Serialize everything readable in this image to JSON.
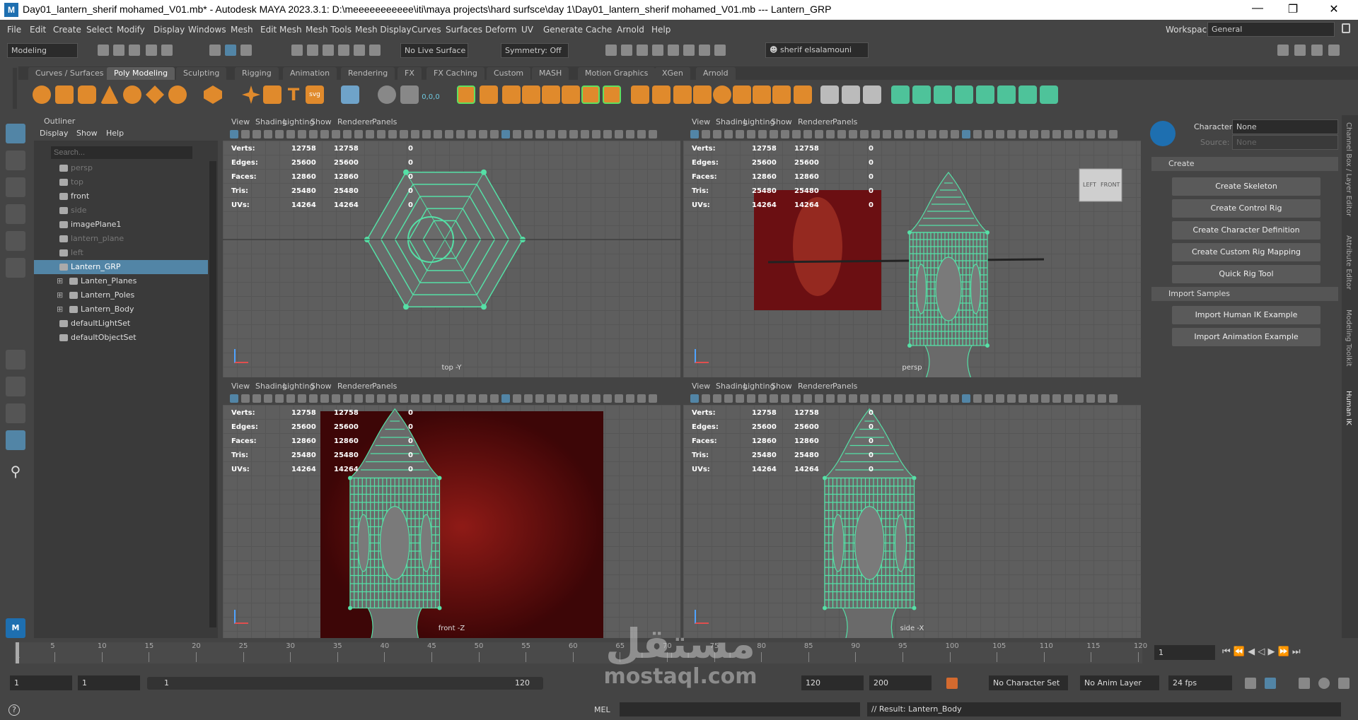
{
  "window": {
    "title": "Day01_lantern_sherif mohamed_V01.mb* - Autodesk MAYA 2023.3.1: D:\\meeeeeeeeeee\\iti\\maya projects\\hard surfsce\\day 1\\Day01_lantern_sherif mohamed_V01.mb  ---  Lantern_GRP",
    "logo": "M"
  },
  "menubar": {
    "items": [
      "File",
      "Edit",
      "Create",
      "Select",
      "Modify",
      "Display",
      "Windows",
      "Mesh",
      "Edit Mesh",
      "Mesh Tools",
      "Mesh Display",
      "Curves",
      "Surfaces",
      "Deform",
      "UV",
      "Generate",
      "Cache",
      "Arnold",
      "Help"
    ],
    "workspace_label": "Workspace:",
    "workspace_value": "General"
  },
  "statusline": {
    "mode": "Modeling",
    "live_surface": "No Live Surface",
    "symmetry": "Symmetry: Off",
    "user": "sherif elsalamouni"
  },
  "shelf": {
    "tabs": [
      "Curves / Surfaces",
      "Poly Modeling",
      "Sculpting",
      "Rigging",
      "Animation",
      "Rendering",
      "FX",
      "FX Caching",
      "Custom",
      "MASH",
      "Motion Graphics",
      "XGen",
      "Arnold"
    ],
    "active": "Poly Modeling"
  },
  "outliner": {
    "title": "Outliner",
    "menu": [
      "Display",
      "Show",
      "Help"
    ],
    "search_placeholder": "Search...",
    "items": [
      {
        "label": "persp",
        "dim": true,
        "indent": 0
      },
      {
        "label": "top",
        "dim": true,
        "indent": 0
      },
      {
        "label": "front",
        "dim": false,
        "indent": 0
      },
      {
        "label": "side",
        "dim": true,
        "indent": 0
      },
      {
        "label": "imagePlane1",
        "dim": false,
        "indent": 0
      },
      {
        "label": "lantern_plane",
        "dim": true,
        "indent": 0
      },
      {
        "label": "left",
        "dim": true,
        "indent": 0
      },
      {
        "label": "Lantern_GRP",
        "dim": false,
        "indent": 0,
        "selected": true
      },
      {
        "label": "Lanten_Planes",
        "dim": false,
        "indent": 1
      },
      {
        "label": "Lantern_Poles",
        "dim": false,
        "indent": 1
      },
      {
        "label": "Lantern_Body",
        "dim": false,
        "indent": 1
      },
      {
        "label": "defaultLightSet",
        "dim": false,
        "indent": 0
      },
      {
        "label": "defaultObjectSet",
        "dim": false,
        "indent": 0
      }
    ]
  },
  "viewport_menu": [
    "View",
    "Shading",
    "Lighting",
    "Show",
    "Renderer",
    "Panels"
  ],
  "hud": {
    "labels": [
      "Verts:",
      "Edges:",
      "Faces:",
      "Tris:",
      "UVs:"
    ],
    "col1": [
      "12758",
      "25600",
      "12860",
      "25480",
      "14264"
    ],
    "col2": [
      "12758",
      "25600",
      "12860",
      "25480",
      "14264"
    ],
    "col3": [
      "0",
      "0",
      "0",
      "0",
      "0"
    ]
  },
  "viewports": [
    {
      "camera": "top -Y"
    },
    {
      "camera": "persp"
    },
    {
      "camera": "front -Z"
    },
    {
      "camera": "side -X"
    }
  ],
  "viewcube": {
    "left": "LEFT",
    "front": "FRONT"
  },
  "humanik": {
    "character_label": "Character:",
    "character_value": "None",
    "source_label": "Source:",
    "source_value": "None",
    "create_section": "Create",
    "create_buttons": [
      "Create Skeleton",
      "Create Control Rig",
      "Create Character Definition",
      "Create Custom Rig Mapping",
      "Quick Rig Tool"
    ],
    "import_section": "Import Samples",
    "import_buttons": [
      "Import Human IK Example",
      "Import Animation Example"
    ]
  },
  "side_tabs": [
    "Channel Box / Layer Editor",
    "Attribute Editor",
    "Modeling Toolkit",
    "Human IK"
  ],
  "timeline": {
    "ticks": [
      "5",
      "10",
      "15",
      "20",
      "25",
      "30",
      "35",
      "40",
      "45",
      "50",
      "55",
      "60",
      "65",
      "70",
      "75",
      "80",
      "85",
      "90",
      "95",
      "100",
      "105",
      "110",
      "115",
      "120"
    ],
    "current_frame": "1",
    "first_tick": "1"
  },
  "range": {
    "start": "1",
    "playback_start": "1",
    "slider_start": "1",
    "slider_end": "120",
    "playback_end": "120",
    "end": "200",
    "char_set": "No Character Set",
    "anim_layer": "No Anim Layer",
    "fps": "24 fps"
  },
  "cmdline": {
    "lang": "MEL",
    "result": "// Result: Lantern_Body"
  },
  "watermark": {
    "top": "مستقل",
    "bottom": "mostaql.com"
  },
  "colors": {
    "wire": "#55e0a6",
    "selection": "#5285a6",
    "bg": "#444444",
    "viewport": "#5e5e5e"
  }
}
